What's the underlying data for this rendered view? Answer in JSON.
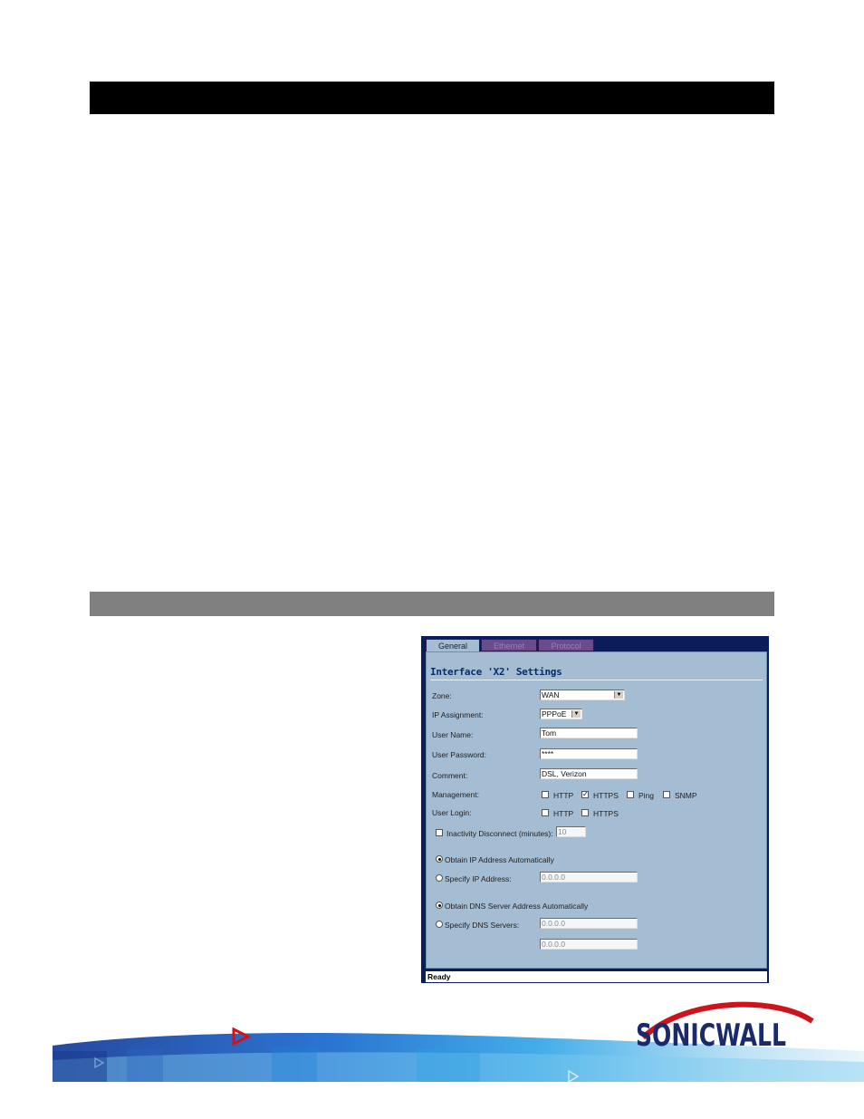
{
  "dialog": {
    "tabs": [
      "General",
      "Ethernet",
      "Protocol"
    ],
    "title": "Interface 'X2' Settings",
    "zone": {
      "label": "Zone:",
      "value": "WAN"
    },
    "ip_assignment": {
      "label": "IP Assignment:",
      "value": "PPPoE"
    },
    "user_name": {
      "label": "User Name:",
      "value": "Tom"
    },
    "user_password": {
      "label": "User Password:",
      "value": "****"
    },
    "comment": {
      "label": "Comment:",
      "value": "DSL, Verizon"
    },
    "management": {
      "label": "Management:",
      "http": "HTTP",
      "https": "HTTPS",
      "ping": "Ping",
      "snmp": "SNMP",
      "https_checked": true
    },
    "user_login": {
      "label": "User Login:",
      "http": "HTTP",
      "https": "HTTPS"
    },
    "inactivity": {
      "label": "Inactivity Disconnect (minutes):",
      "value": "10"
    },
    "obtain_ip_auto": "Obtain IP Address Automatically",
    "specify_ip": {
      "label": "Specify IP Address:",
      "value": "0.0.0.0"
    },
    "obtain_dns_auto": "Obtain DNS Server Address Automatically",
    "specify_dns": {
      "label": "Specify DNS Servers:",
      "value1": "0.0.0.0",
      "value2": "0.0.0.0"
    },
    "status": "Ready"
  },
  "brand": {
    "logo_text": "SONICWALL",
    "accent": "#d0121b",
    "navy": "#1a2a6c"
  },
  "colors": {
    "panel": "#a4bdd2",
    "tab_inactive": "#6a4c8c",
    "frame": "#0a1d5a"
  }
}
